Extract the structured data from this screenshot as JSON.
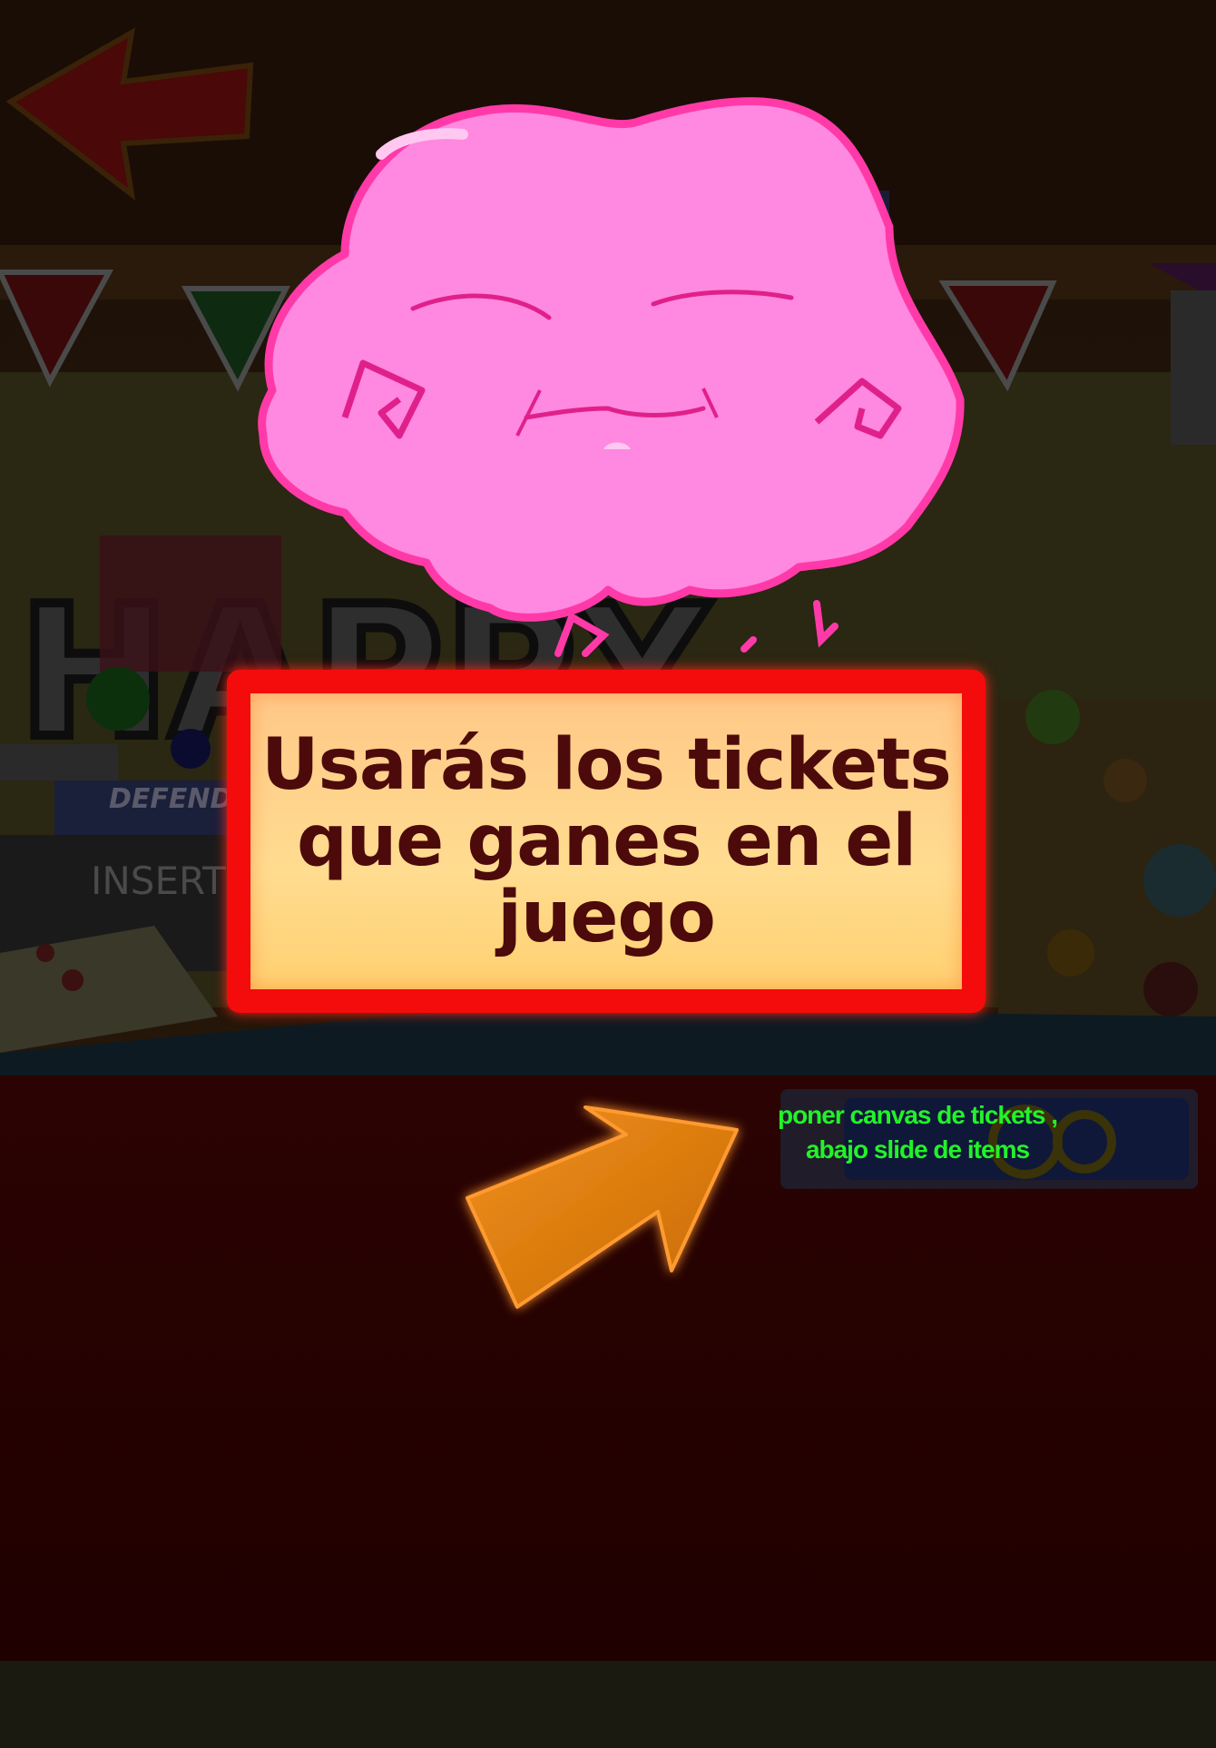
{
  "tutorial": {
    "message": "Usarás los tickets que ganes en el juego",
    "dev_note": "poner canvas de tickets , abajo slide de items"
  },
  "background": {
    "sign_letters": "HAPPY",
    "machine_label_1": "DEFENDER",
    "machine_label_2": "INSERT"
  },
  "icons": {
    "back": "back-arrow-icon",
    "mascot": "pink-cloud-mascot",
    "pointer": "orange-pointer-arrow-icon"
  },
  "colors": {
    "mascot_fill": "#ff88e0",
    "mascot_outline": "#ff3aa8",
    "dialog_border": "#f40c0c",
    "dialog_fill": "#ffd282",
    "dialog_text": "#4d0a0a",
    "pointer_arrow": "#e07a0a",
    "dev_note_text": "#22f22a",
    "overlay_floor": "#2a0000"
  }
}
